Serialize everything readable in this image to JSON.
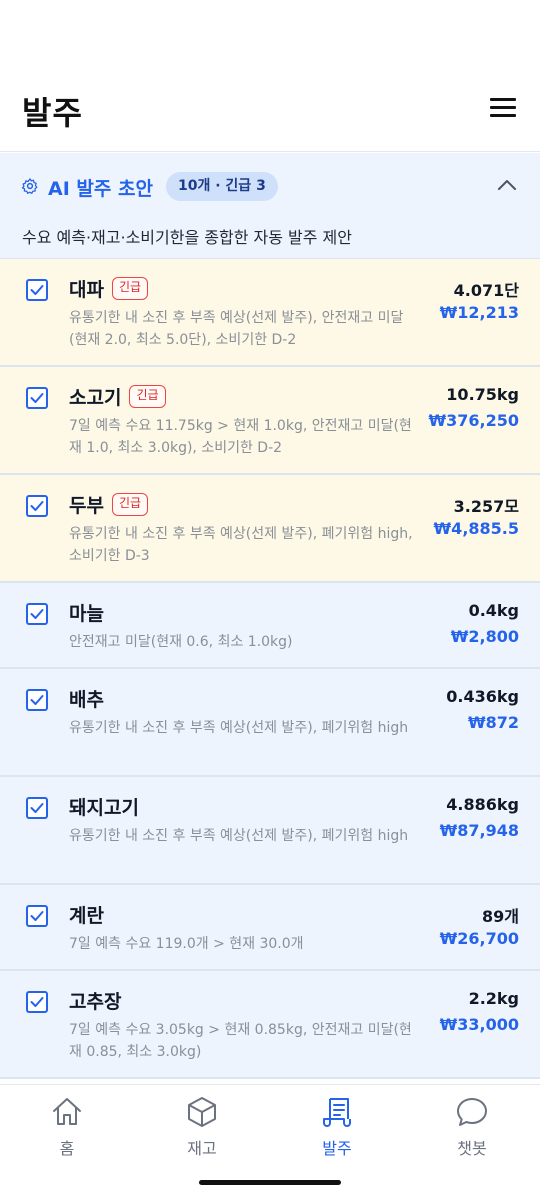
{
  "header": {
    "title": "발주"
  },
  "ai_panel": {
    "title": "AI 발주 초안",
    "badge": "10개 · 긴급 3",
    "description": "수요 예측·재고·소비기한을 종합한 자동 발주 제안"
  },
  "items": [
    {
      "name": "대파",
      "tag": "긴급",
      "urgent": true,
      "checked": true,
      "desc": "유통기한 내 소진 후 부족 예상(선제 발주), 안전재고 미달(현재 2.0, 최소 5.0단), 소비기한 D-2",
      "qty": "4.071단",
      "price": "₩12,213"
    },
    {
      "name": "소고기",
      "tag": "긴급",
      "urgent": true,
      "checked": true,
      "desc": "7일 예측 수요 11.75kg > 현재 1.0kg, 안전재고 미달(현재 1.0, 최소 3.0kg), 소비기한 D-2",
      "qty": "10.75kg",
      "price": "₩376,250"
    },
    {
      "name": "두부",
      "tag": "긴급",
      "urgent": true,
      "checked": true,
      "desc": "유통기한 내 소진 후 부족 예상(선제 발주), 폐기위험 high, 소비기한 D-3",
      "qty": "3.257모",
      "price": "₩4,885.5"
    },
    {
      "name": "마늘",
      "tag": "",
      "urgent": false,
      "checked": true,
      "desc": "안전재고 미달(현재 0.6, 최소 1.0kg)",
      "qty": "0.4kg",
      "price": "₩2,800"
    },
    {
      "name": "배추",
      "tag": "",
      "urgent": false,
      "checked": true,
      "desc": "유통기한 내 소진 후 부족 예상(선제 발주), 폐기위험 high",
      "qty": "0.436kg",
      "price": "₩872"
    },
    {
      "name": "돼지고기",
      "tag": "",
      "urgent": false,
      "checked": true,
      "desc": "유통기한 내 소진 후 부족 예상(선제 발주), 폐기위험 high",
      "qty": "4.886kg",
      "price": "₩87,948"
    },
    {
      "name": "계란",
      "tag": "",
      "urgent": false,
      "checked": true,
      "desc": "7일 예측 수요 119.0개 > 현재 30.0개",
      "qty": "89개",
      "price": "₩26,700"
    },
    {
      "name": "고추장",
      "tag": "",
      "urgent": false,
      "checked": true,
      "desc": "7일 예측 수요 3.05kg > 현재 0.85kg, 안전재고 미달(현재 0.85, 최소 3.0kg)",
      "qty": "2.2kg",
      "price": "₩33,000"
    }
  ],
  "tabs": [
    {
      "label": "홈",
      "icon": "home-icon",
      "active": false
    },
    {
      "label": "재고",
      "icon": "box-icon",
      "active": false
    },
    {
      "label": "발주",
      "icon": "order-scroll-icon",
      "active": true
    },
    {
      "label": "챗봇",
      "icon": "chat-bubble-icon",
      "active": false
    }
  ],
  "colors": {
    "accent": "#2563eb",
    "urgent_bg": "#fdf9e6",
    "normal_bg": "#eef4fd",
    "urgent_tag": "#dc2626"
  }
}
